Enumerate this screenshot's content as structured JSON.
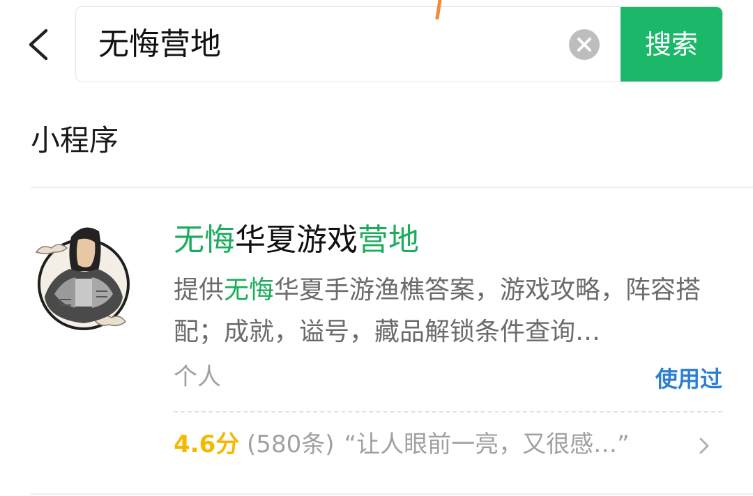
{
  "header": {
    "back_icon": "chevron-left-icon",
    "search": {
      "value": "无悔营地",
      "clear_icon": "clear-circle-icon"
    },
    "search_button_label": "搜索",
    "accent_color": "#1ab868"
  },
  "section": {
    "title": "小程序"
  },
  "result": {
    "title_parts": [
      "无悔",
      "华夏游戏",
      "营地"
    ],
    "desc_parts": [
      "提供",
      "无悔",
      "华夏手游渔樵答案，游戏攻略，阵容搭配；成就，谥号，藏品解锁条件查询…"
    ],
    "type": "个人",
    "used_label": "使用过",
    "rating": {
      "score": "4.6分",
      "count": "(580条)",
      "quote": "“让人眼前一亮，又很感…”"
    },
    "highlight_color": "#1aad5c",
    "score_color": "#f5b800"
  }
}
